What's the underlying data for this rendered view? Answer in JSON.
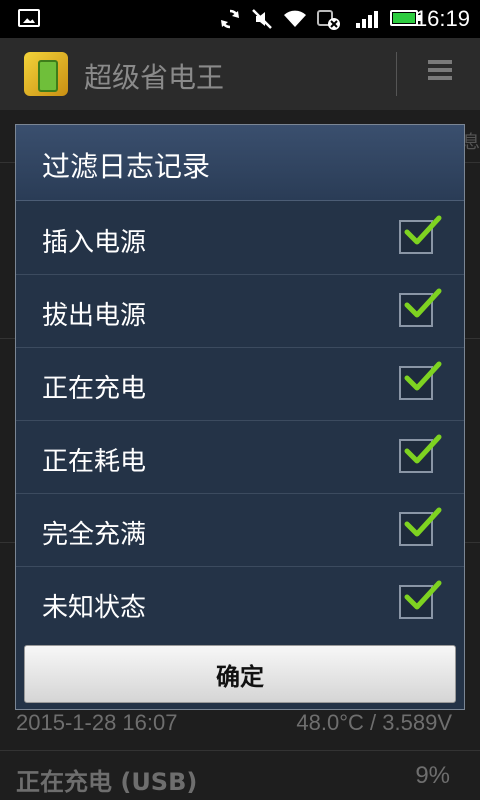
{
  "status_bar": {
    "time": "16:19",
    "battery_color": "#2ecc40",
    "icons": [
      "picture-icon",
      "sync-icon",
      "mute-vibrate-icon",
      "wifi-icon",
      "data-off-icon",
      "signal-icon",
      "battery-icon"
    ]
  },
  "app": {
    "title": "超级省电王",
    "menu_icon": "menu-icon"
  },
  "background": {
    "row_date": "2015-1-28  16:07",
    "row_temp": "48.0°C / 3.589V",
    "row_status": "正在充电 (USB)",
    "row_percent": "9%",
    "edge_text": "息"
  },
  "dialog": {
    "title": "过滤日志记录",
    "options": [
      {
        "label": "插入电源",
        "checked": true
      },
      {
        "label": "拔出电源",
        "checked": true
      },
      {
        "label": "正在充电",
        "checked": true
      },
      {
        "label": "正在耗电",
        "checked": true
      },
      {
        "label": "完全充满",
        "checked": true
      },
      {
        "label": "未知状态",
        "checked": true
      }
    ],
    "ok_label": "确定",
    "check_color": "#7ed321"
  }
}
